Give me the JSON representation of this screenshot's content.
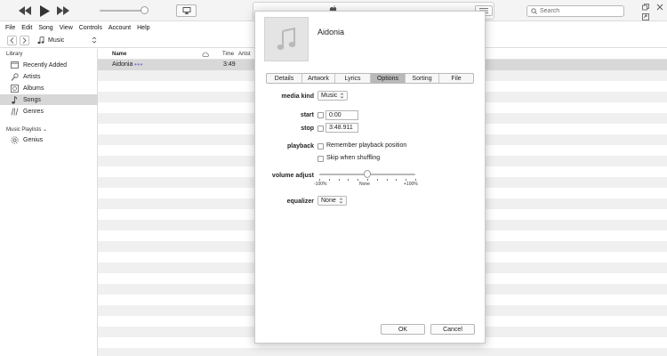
{
  "player": {
    "search_placeholder": "Search",
    "volume_level": 0.88
  },
  "menubar": [
    "File",
    "Edit",
    "Song",
    "View",
    "Controls",
    "Account",
    "Help"
  ],
  "nav": {
    "media_label": "Music"
  },
  "sidebar": {
    "library_heading": "Library",
    "items": [
      {
        "label": "Recently Added",
        "icon": "recently-added-icon"
      },
      {
        "label": "Artists",
        "icon": "microphone-icon"
      },
      {
        "label": "Albums",
        "icon": "album-icon"
      },
      {
        "label": "Songs",
        "icon": "note-icon",
        "selected": true
      },
      {
        "label": "Genres",
        "icon": "genres-icon"
      }
    ],
    "playlists_heading": "Music Playlists ⌄",
    "playlists": [
      {
        "label": "Genius",
        "icon": "genius-icon"
      }
    ]
  },
  "song_list": {
    "columns": {
      "name": "Name",
      "time": "Time",
      "artist": "Artist"
    },
    "rows": [
      {
        "name": "Aidonia",
        "dots": "•••",
        "time": "3:49"
      }
    ]
  },
  "dialog": {
    "song_title": "Aidonia",
    "tabs": [
      "Details",
      "Artwork",
      "Lyrics",
      "Options",
      "Sorting",
      "File"
    ],
    "active_tab": "Options",
    "media_kind_label": "media kind",
    "media_kind_value": "Music",
    "start_label": "start",
    "start_value": "0:00",
    "stop_label": "stop",
    "stop_value": "3:48.911",
    "playback_label": "playback",
    "remember_label": "Remember playback position",
    "skip_label": "Skip when shuffling",
    "volume_label": "volume adjust",
    "volume_min": "-100%",
    "volume_mid": "None",
    "volume_max": "+100%",
    "volume_value": 0,
    "equalizer_label": "equalizer",
    "equalizer_value": "None",
    "ok_label": "OK",
    "cancel_label": "Cancel"
  }
}
